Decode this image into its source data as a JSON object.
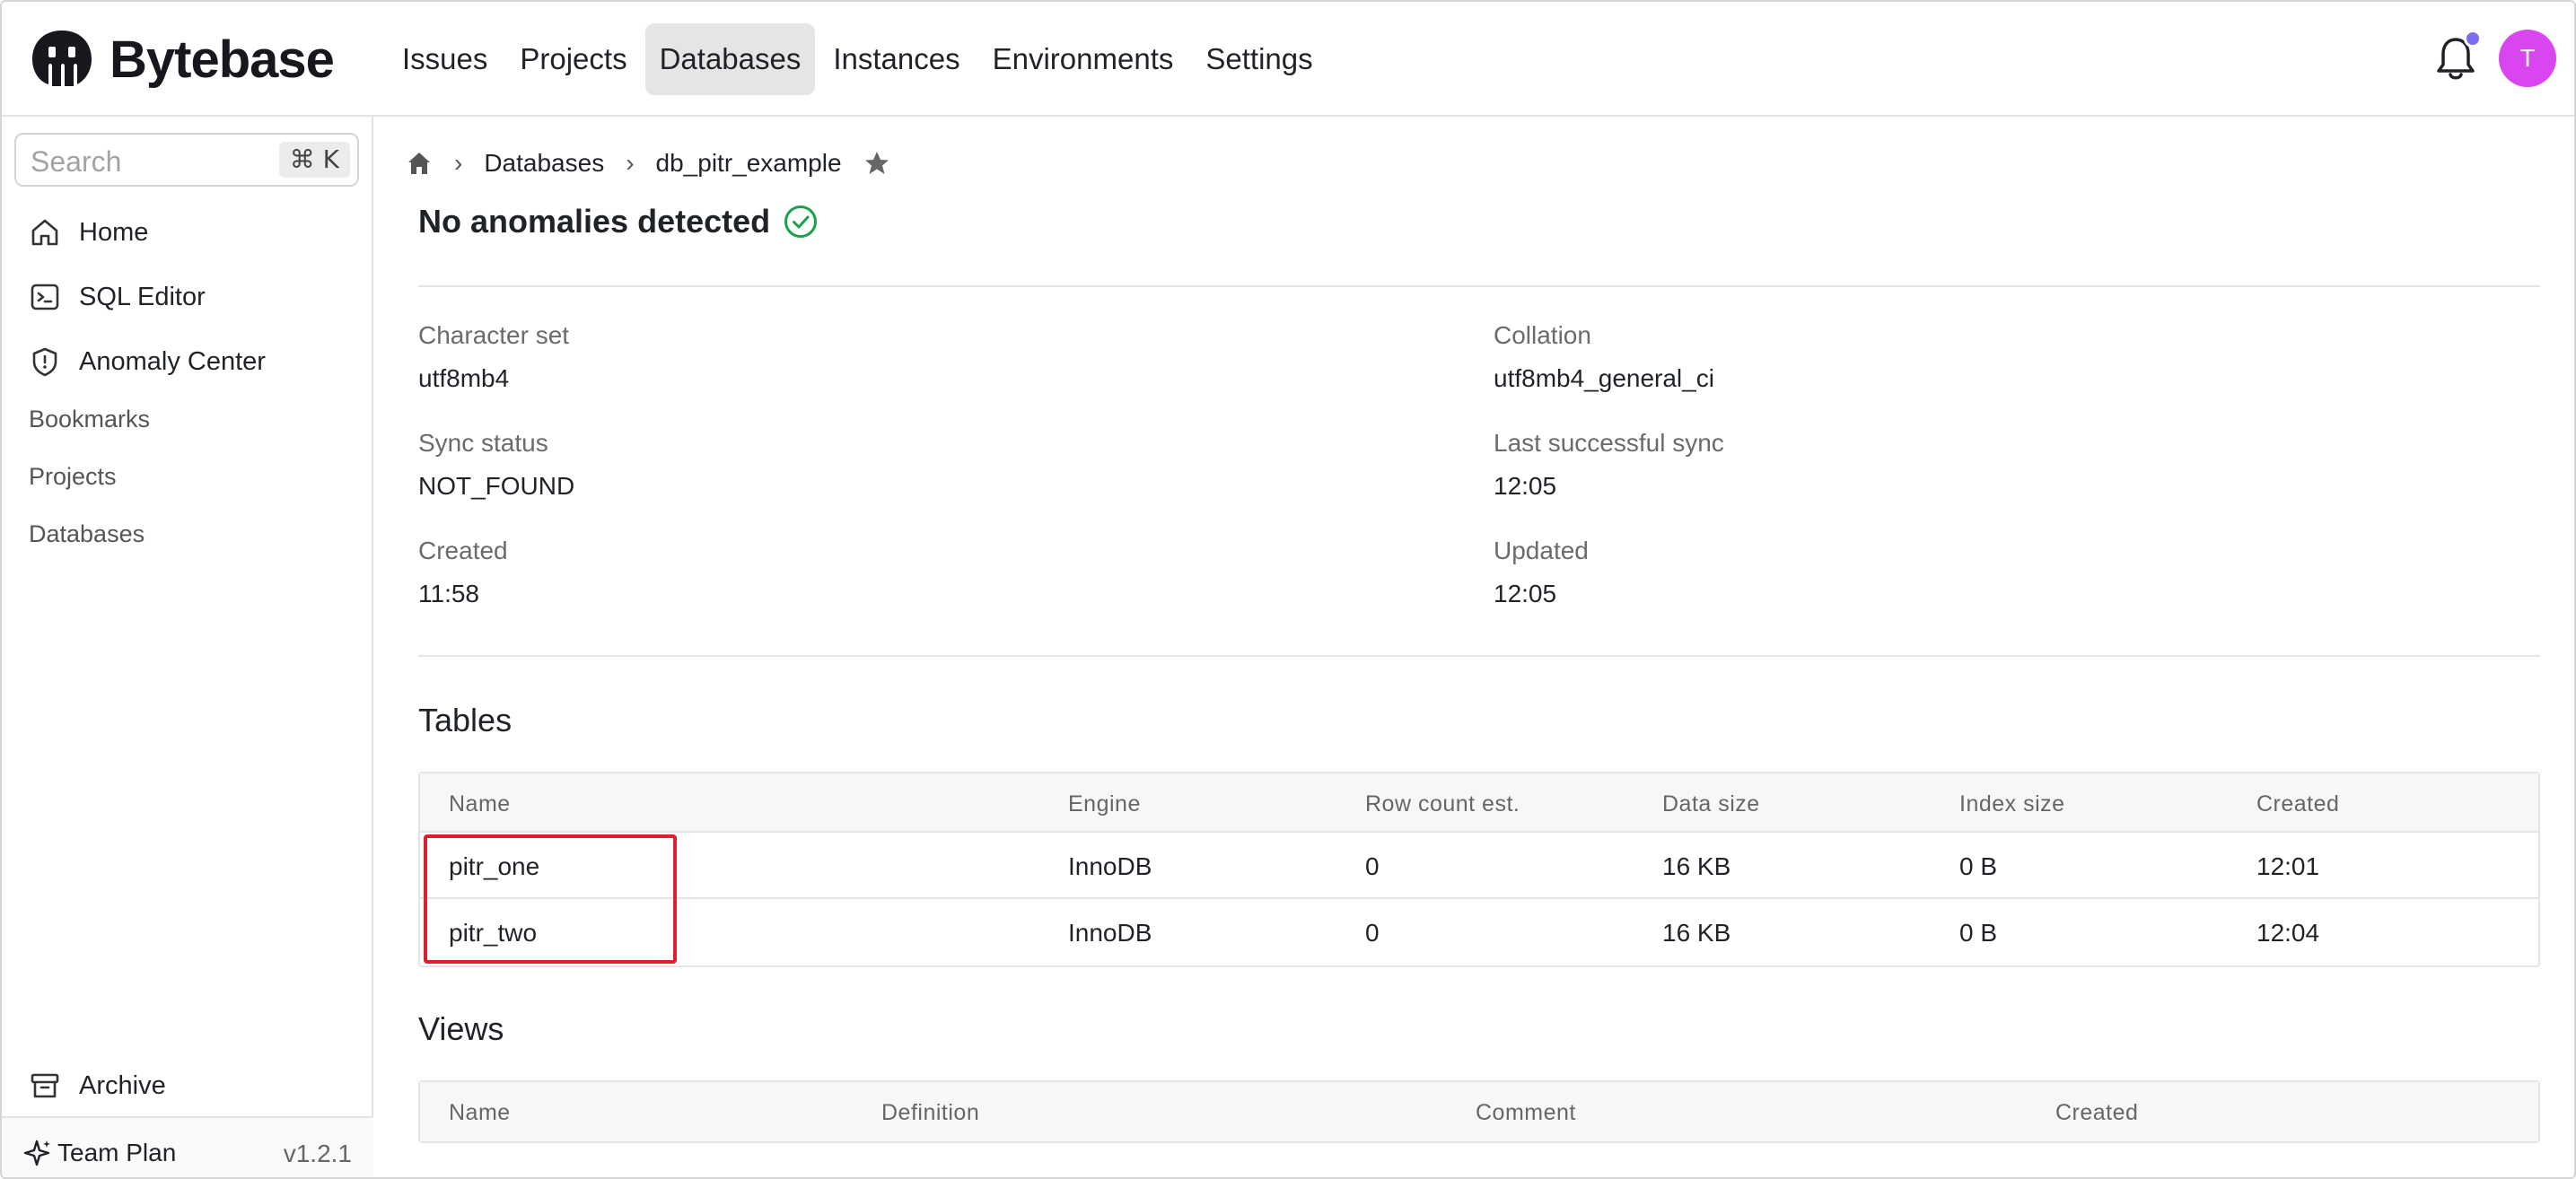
{
  "app": {
    "brand": "Bytebase",
    "nav": [
      "Issues",
      "Projects",
      "Databases",
      "Instances",
      "Environments",
      "Settings"
    ],
    "active_nav": "Databases",
    "avatar_initial": "T",
    "notification_dot_color": "#7c6cf0",
    "avatar_color": "#d946ef"
  },
  "sidebar": {
    "search_placeholder": "Search",
    "search_shortcut": "⌘ K",
    "items": [
      {
        "label": "Home",
        "icon": "home-icon"
      },
      {
        "label": "SQL Editor",
        "icon": "terminal-icon"
      },
      {
        "label": "Anomaly Center",
        "icon": "shield-icon"
      }
    ],
    "links": [
      "Bookmarks",
      "Projects",
      "Databases"
    ],
    "archive": {
      "label": "Archive",
      "icon": "archive-icon"
    },
    "plan": "Team Plan",
    "version": "v1.2.1"
  },
  "breadcrumb": {
    "home_icon": "home-icon",
    "items": [
      "Databases",
      "db_pitr_example"
    ],
    "star_icon": "star-icon"
  },
  "anomaly": {
    "text": "No anomalies detected",
    "icon": "check-circle-icon",
    "icon_color": "#16a34a"
  },
  "info": {
    "character_set": {
      "label": "Character set",
      "value": "utf8mb4"
    },
    "collation": {
      "label": "Collation",
      "value": "utf8mb4_general_ci"
    },
    "sync_status": {
      "label": "Sync status",
      "value": "NOT_FOUND"
    },
    "last_sync": {
      "label": "Last successful sync",
      "value": "12:05"
    },
    "created": {
      "label": "Created",
      "value": "11:58"
    },
    "updated": {
      "label": "Updated",
      "value": "12:05"
    }
  },
  "tables": {
    "title": "Tables",
    "columns": [
      "Name",
      "Engine",
      "Row count est.",
      "Data size",
      "Index size",
      "Created"
    ],
    "rows": [
      [
        "pitr_one",
        "InnoDB",
        "0",
        "16 KB",
        "0 B",
        "12:01"
      ],
      [
        "pitr_two",
        "InnoDB",
        "0",
        "16 KB",
        "0 B",
        "12:04"
      ]
    ]
  },
  "views": {
    "title": "Views",
    "columns": [
      "Name",
      "Definition",
      "Comment",
      "Created"
    ]
  },
  "annotation": {
    "highlight_color": "#e11d2e"
  }
}
